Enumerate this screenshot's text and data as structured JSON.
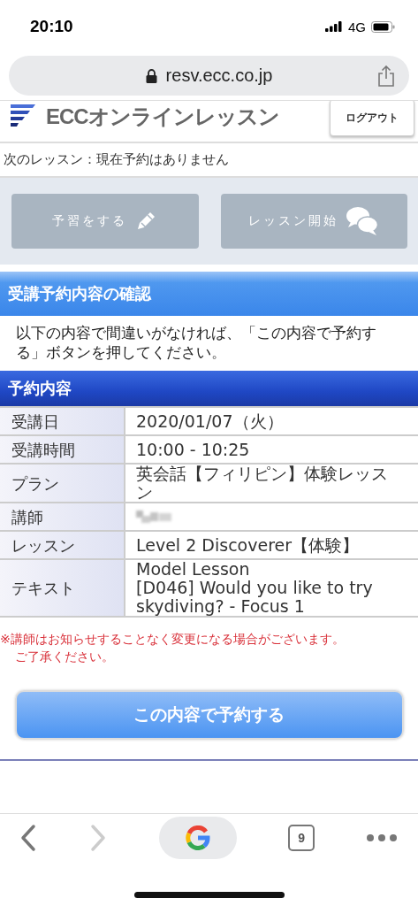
{
  "status_bar": {
    "time": "20:10",
    "network": "4G"
  },
  "url_bar": {
    "url": "resv.ecc.co.jp"
  },
  "header": {
    "logo": "ECCオンラインレッスン",
    "logout_button": "ログアウト"
  },
  "next_lesson": "次のレッスン：現在予約はありません",
  "action_buttons": [
    {
      "label": "予習をする",
      "disabled": true
    },
    {
      "label": "レッスン開始",
      "disabled": true
    }
  ],
  "section_title": "受講予約内容の確認",
  "instructions": "以下の内容で間違いがなければ、「この内容で予約する」ボタンを押してください。",
  "table": {
    "title": "予約内容",
    "rows": [
      {
        "label": "受講日",
        "value": "2020/01/07（火）"
      },
      {
        "label": "受講時間",
        "value": "10:00 - 10:25"
      },
      {
        "label": "プラン",
        "value": "英会話【フィリピン】体験レッスン"
      },
      {
        "label": "講師",
        "kind": "redacted"
      },
      {
        "label": "レッスン",
        "value": "Level 2 Discoverer【体験】"
      },
      {
        "label": "テキスト",
        "value": "Model Lesson\n[D046] Would you like to try skydiving? - Focus 1"
      }
    ]
  },
  "notice": [
    "※講師はお知らせすることなく変更になる場合がございます。",
    "ご了承ください。"
  ],
  "confirm_button": "この内容で予約する",
  "browser_toolbar": {
    "back_enabled": true,
    "forward_enabled": false,
    "tab_count": "9"
  }
}
